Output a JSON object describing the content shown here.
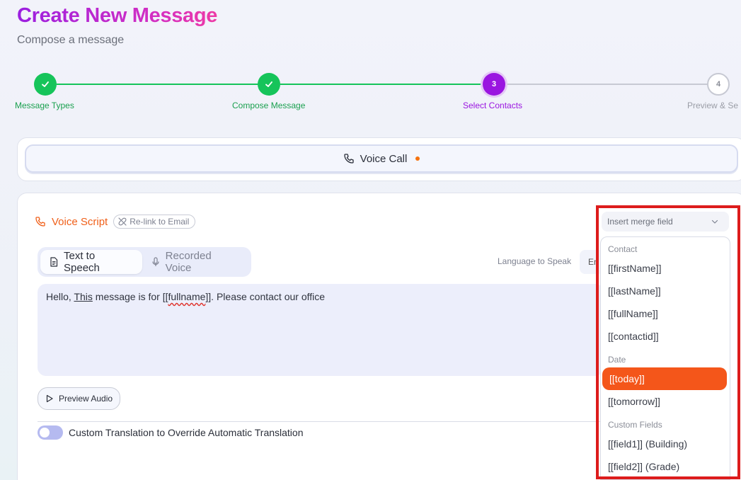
{
  "header": {
    "title": "Create New Message",
    "subtitle": "Compose a message"
  },
  "stepper": {
    "steps": [
      {
        "label": "Message Types",
        "state": "done"
      },
      {
        "label": "Compose Message",
        "state": "done"
      },
      {
        "label": "Select Contacts",
        "state": "current",
        "number": "3"
      },
      {
        "label": "Preview & Se",
        "state": "todo",
        "number": "4"
      }
    ]
  },
  "channel": {
    "label": "Voice Call",
    "icon": "phone-icon"
  },
  "voice_script": {
    "label": "Voice Script",
    "relink_label": "Re-link to Email",
    "tabs": [
      {
        "label": "Text to Speech",
        "icon": "document-icon",
        "active": true
      },
      {
        "label": "Recorded Voice",
        "icon": "microphone-icon",
        "active": false
      }
    ],
    "language_label": "Language to Speak",
    "language_value": "En",
    "script": {
      "p1": "Hello, ",
      "p2": "This",
      "p3": " message is for [[",
      "p4": "fullname",
      "p5": "]]. Please contact our office"
    },
    "preview_label": "Preview Audio",
    "toggle_label": "Custom Translation to Override Automatic Translation"
  },
  "merge": {
    "placeholder": "Insert merge field",
    "groups": [
      {
        "name": "Contact",
        "items": [
          "[[firstName]]",
          "[[lastName]]",
          "[[fullName]]",
          "[[contactid]]"
        ]
      },
      {
        "name": "Date",
        "items": [
          "[[today]]",
          "[[tomorrow]]"
        ]
      },
      {
        "name": "Custom Fields",
        "items": [
          "[[field1]] (Building)",
          "[[field2]] (Grade)"
        ]
      }
    ],
    "selected": "[[today]]"
  },
  "colors": {
    "accent_orange": "#f4561a",
    "step_done": "#16c45a",
    "step_current": "#9a15e0",
    "highlight_border": "#dd1c1c"
  }
}
